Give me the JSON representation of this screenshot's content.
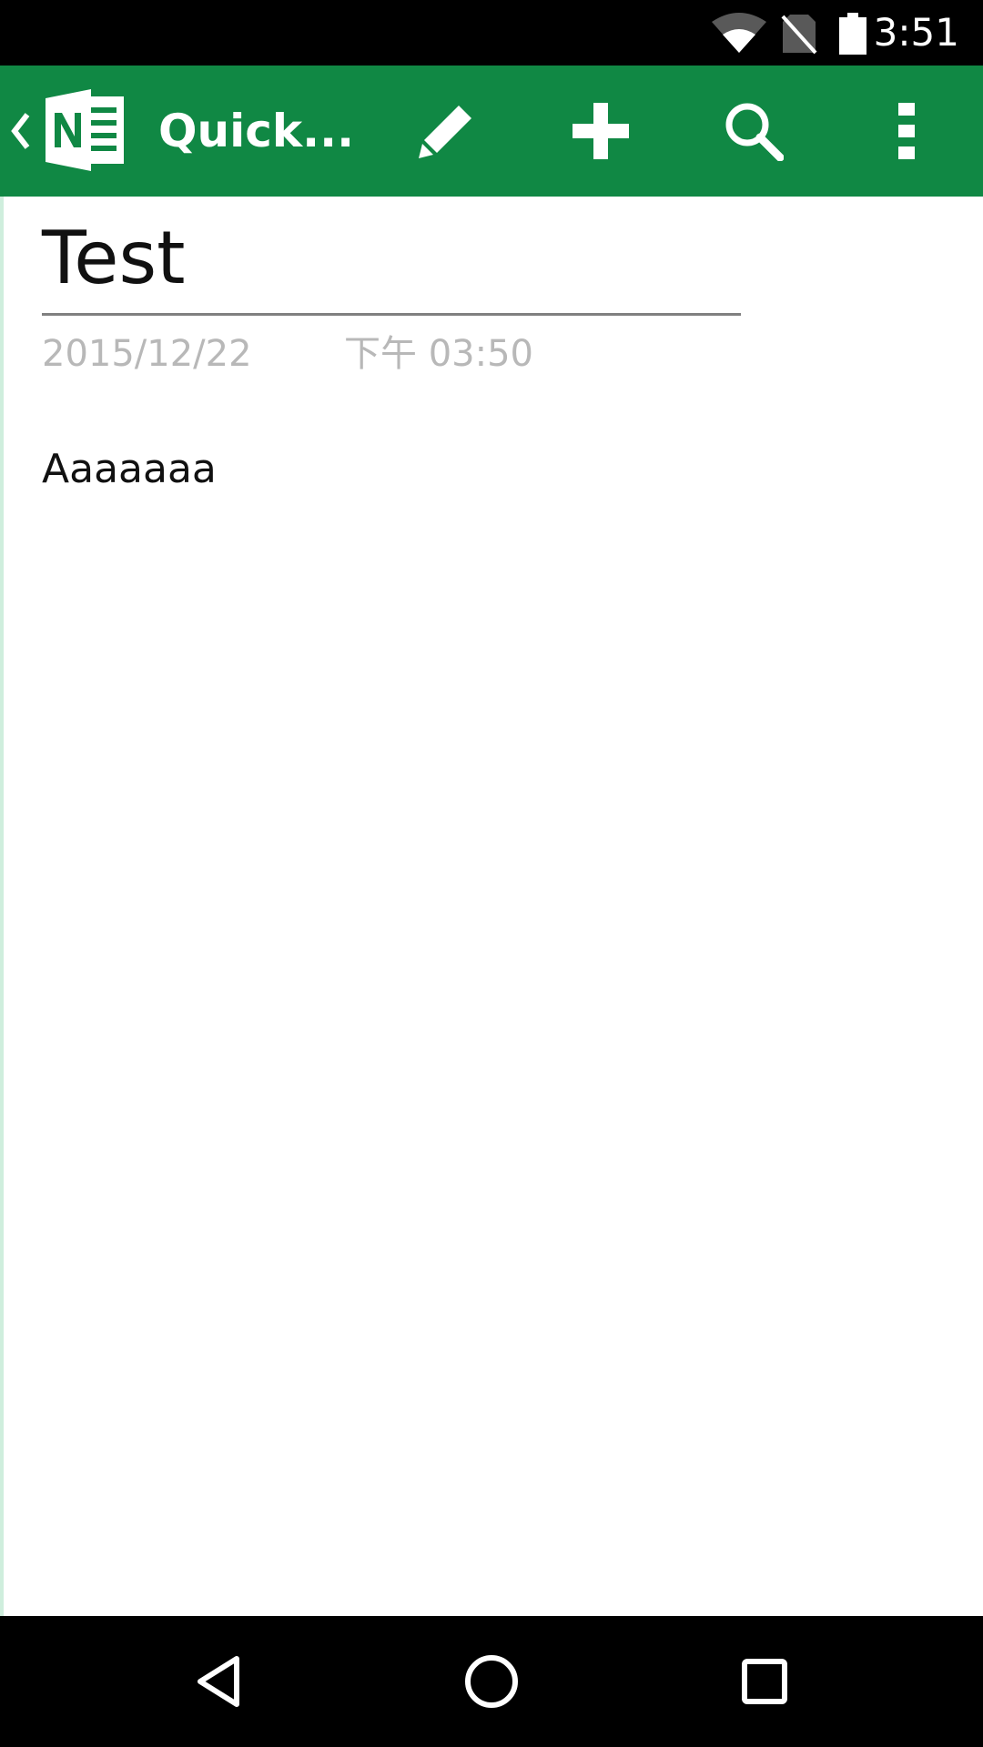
{
  "status_bar": {
    "time": "3:51",
    "icons": [
      "wifi-icon",
      "no-sim-icon",
      "battery-icon"
    ]
  },
  "app_bar": {
    "title": "Quick...",
    "color": "#108844",
    "actions": [
      "edit-icon",
      "add-icon",
      "search-icon",
      "overflow-menu-icon"
    ]
  },
  "note": {
    "title": "Test",
    "date": "2015/12/22",
    "time": "下午 03:50",
    "body": "Aaaaaaa"
  },
  "nav_bar": {
    "buttons": [
      "back-icon",
      "home-icon",
      "recents-icon"
    ]
  }
}
